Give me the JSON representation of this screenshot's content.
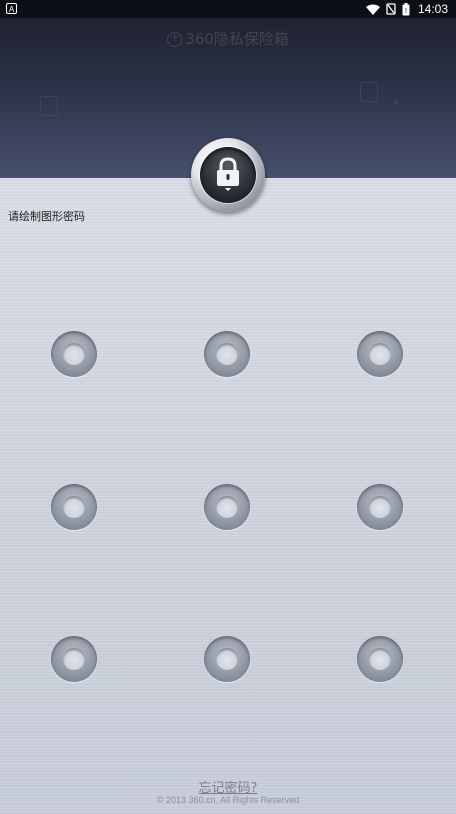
{
  "status_bar": {
    "left_badge": "A",
    "time": "14:03",
    "icons": [
      "wifi-icon",
      "sim-blocked-icon",
      "battery-icon"
    ]
  },
  "header": {
    "title": "360隐私保险箱",
    "logo_icon": "plus-circle-icon"
  },
  "lock": {
    "icon": "padlock-icon"
  },
  "prompt": "请绘制图形密码",
  "pattern": {
    "nodes": [
      1,
      2,
      3,
      4,
      5,
      6,
      7,
      8,
      9
    ]
  },
  "footer": {
    "forgot_password": "忘记密码?",
    "copyright": "© 2013 360.cn, All Rights Reserved"
  },
  "colors": {
    "header_top": "#1e2230",
    "header_bottom": "#47506e",
    "body_bg": "#cdd2dc",
    "link": "#7a7f8a"
  }
}
